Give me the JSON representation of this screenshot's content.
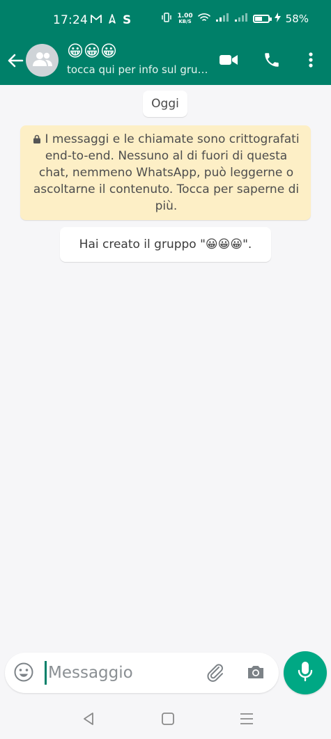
{
  "status_bar": {
    "time": "17:24",
    "left_icons": [
      "gmail-icon",
      "navigation-icon",
      "s-app-icon"
    ],
    "net_speed_value": "1.00",
    "net_speed_unit": "KB/S",
    "battery_percent": "58%",
    "battery_level": 0.58
  },
  "toolbar": {
    "group_name": "😀😀😀",
    "subtitle": "tocca qui per info sul gruppo",
    "icons": [
      "back-arrow-icon",
      "group-avatar-icon",
      "video-call-icon",
      "phone-call-icon",
      "more-options-icon"
    ]
  },
  "chat": {
    "date_chip": "Oggi",
    "encryption_notice": "I messaggi e le chiamate sono crittografati end-to-end. Nessuno al di fuori di questa chat, nemmeno WhatsApp, può leggerne o ascoltarne il contenuto. Tocca per saperne di più.",
    "system_message": "Hai creato il gruppo \"😀😀😀\"."
  },
  "input_bar": {
    "placeholder": "Messaggio",
    "value": ""
  },
  "colors": {
    "header": "#008069",
    "accent": "#00a884",
    "notice_bg": "#fdefc6",
    "chat_bg": "#f6f6f8"
  }
}
